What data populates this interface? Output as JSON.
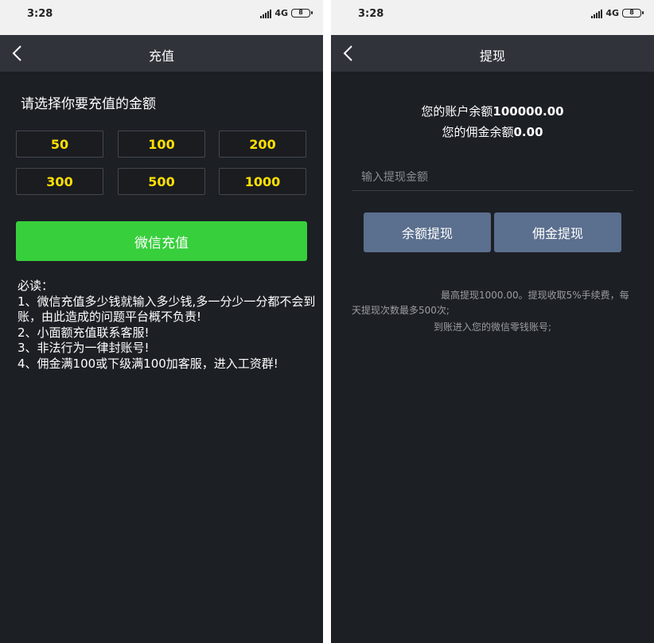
{
  "recharge": {
    "status": {
      "time": "3:28",
      "network": "4G",
      "battery": "8"
    },
    "title": "充值",
    "prompt": "请选择你要充值的金额",
    "amounts": [
      "50",
      "100",
      "200",
      "300",
      "500",
      "1000"
    ],
    "wechat_button": "微信充值",
    "notes": {
      "heading": "必读：",
      "items": [
        "1、微信充值多少钱就输入多少钱,多一分少一分都不会到账，由此造成的问题平台概不负责!",
        "2、小面额充值联系客服!",
        "3、非法行为一律封账号!",
        "4、佣金满100或下级满100加客服，进入工资群!"
      ]
    }
  },
  "withdraw": {
    "status": {
      "time": "3:28",
      "network": "4G",
      "battery": "8"
    },
    "title": "提现",
    "balance": {
      "label": "您的账户余额",
      "value": "100000.00"
    },
    "commission": {
      "label": "您的佣金余额",
      "value": "0.00"
    },
    "input_placeholder": "输入提现金额",
    "balance_button": "余额提现",
    "commission_button": "佣金提现",
    "rules": [
      "最高提现1000.00。提现收取5%手续费，每天提现次数最多500次;",
      "到账进入您的微信零钱账号;"
    ],
    "colors": {
      "button": "#5b6f8e"
    }
  },
  "colors": {
    "amount_text": "#ffe000",
    "wechat_green": "#37cf3c",
    "background": "#1c1f24"
  }
}
